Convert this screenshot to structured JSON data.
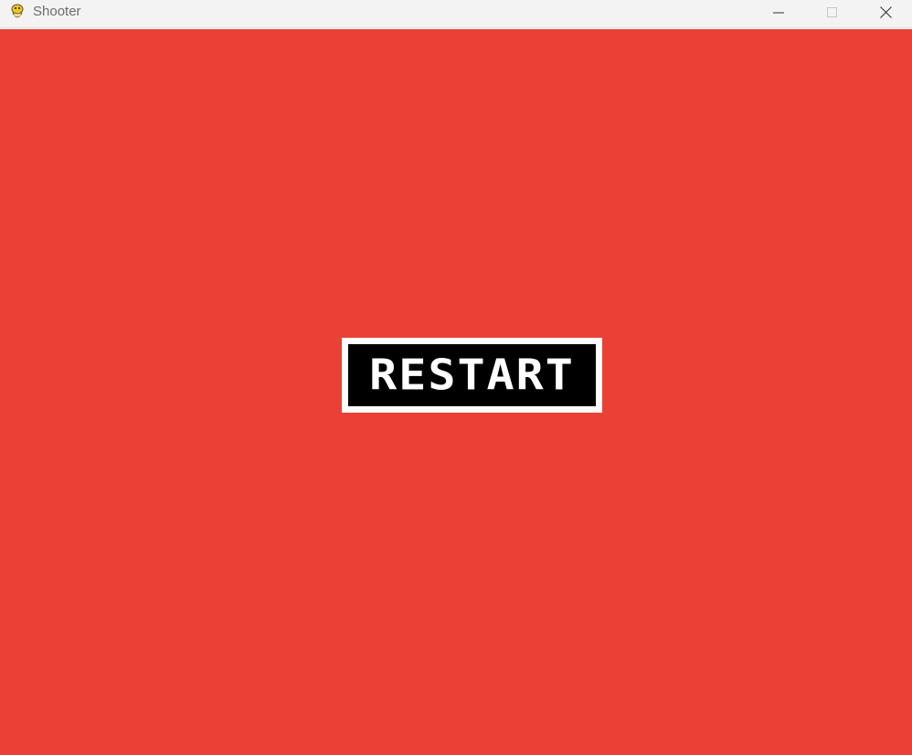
{
  "window": {
    "title": "Shooter",
    "app_icon": "pygame-snake-icon",
    "controls": {
      "minimize_icon": "minimize-icon",
      "maximize_icon": "maximize-icon",
      "close_icon": "close-icon"
    }
  },
  "game": {
    "background_color": "#ea4136",
    "restart_button": {
      "label": "RESTART",
      "border_color": "#ffffff",
      "fill_color": "#000000",
      "text_color": "#ffffff"
    }
  }
}
